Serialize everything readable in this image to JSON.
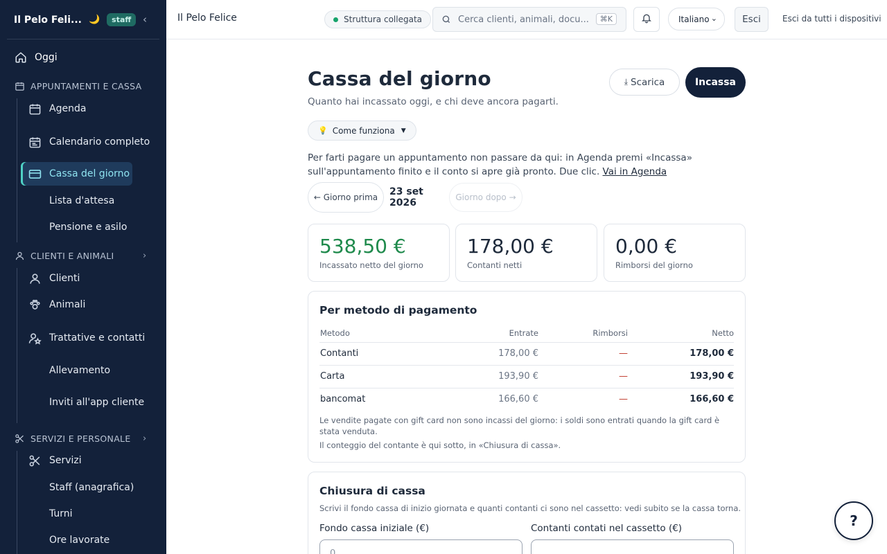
{
  "app": {
    "brand": "Il Pelo Feli...",
    "role_badge": "staff"
  },
  "sidebar": {
    "today": "Oggi",
    "sections": [
      {
        "title": "APPUNTAMENTI E CASSA",
        "items": [
          "Agenda",
          "Calendario completo",
          "Cassa del giorno",
          "Lista d'attesa",
          "Pensione e asilo"
        ]
      },
      {
        "title": "CLIENTI E ANIMALI",
        "items": [
          "Clienti",
          "Animali",
          "Trattative e contatti",
          "Allevamento",
          "Inviti all'app cliente"
        ]
      },
      {
        "title": "SERVIZI E PERSONALE",
        "items": [
          "Servizi",
          "Staff (anagrafica)",
          "Turni",
          "Ore lavorate"
        ]
      }
    ],
    "active_item": "Cassa del giorno"
  },
  "topbar": {
    "title": "Il Pelo Felice",
    "status": "Struttura collegata",
    "search_placeholder": "Cerca clienti, animali, docu...",
    "search_shortcut": "⌘K",
    "language": "Italiano",
    "logout": "Esci",
    "logout_all": "Esci da tutti i dispositivi"
  },
  "page": {
    "title": "Cassa del giorno",
    "subtitle": "Quanto hai incassato oggi, e chi deve ancora pagarti.",
    "download_label": "Scarica",
    "collect_label": "Incassa",
    "howto_label": "Come funziona",
    "tip_text": "Per farti pagare un appuntamento non passare da qui: in Agenda premi «Incassa» sull'appuntamento finito e il conto si apre già pronto. Due clic.",
    "tip_link": "Vai in Agenda",
    "prev_day": "← Giorno prima",
    "date": "23 set 2026",
    "next_day": "Giorno dopo →"
  },
  "stats": [
    {
      "value": "538,50 €",
      "label": "Incassato netto del giorno",
      "color": "#1f8a4c"
    },
    {
      "value": "178,00 €",
      "label": "Contanti netti"
    },
    {
      "value": "0,00 €",
      "label": "Rimborsi del giorno"
    }
  ],
  "payments": {
    "title": "Per metodo di pagamento",
    "headers": {
      "method": "Metodo",
      "in": "Entrate",
      "refunds": "Rimborsi",
      "net": "Netto"
    },
    "rows": [
      {
        "method": "Contanti",
        "in": "178,00 €",
        "refunds": "—",
        "net": "178,00 €"
      },
      {
        "method": "Carta",
        "in": "193,90 €",
        "refunds": "—",
        "net": "193,90 €"
      },
      {
        "method": "bancomat",
        "in": "166,60 €",
        "refunds": "—",
        "net": "166,60 €"
      }
    ],
    "note1": "Le vendite pagate con gift card non sono incassi del giorno: i soldi sono entrati quando la gift card è stata venduta.",
    "note2": "Il conteggio del contante è qui sotto, in «Chiusura di cassa»."
  },
  "closing": {
    "title": "Chiusura di cassa",
    "description": "Scrivi il fondo cassa di inizio giornata e quanti contanti ci sono nel cassetto: vedi subito se la cassa torna.",
    "float_label": "Fondo cassa iniziale (€)",
    "float_value": "0",
    "counted_label": "Contanti contati nel cassetto (€)",
    "counted_value": ""
  },
  "help_label": "?"
}
